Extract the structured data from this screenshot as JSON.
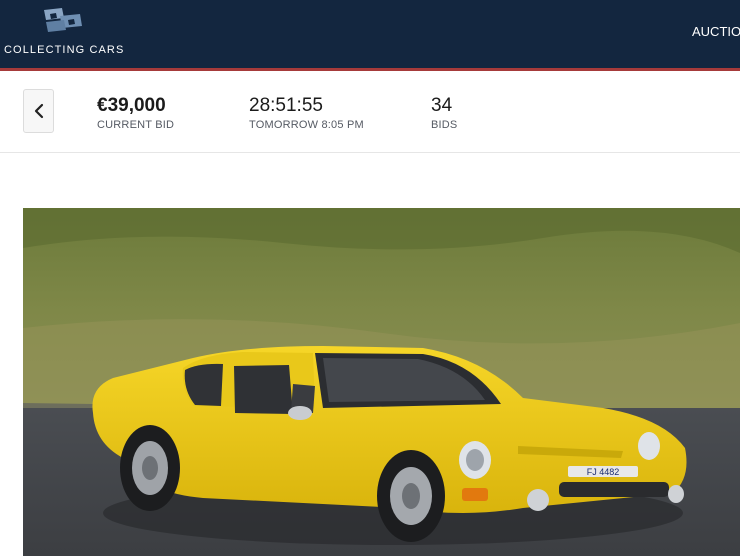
{
  "header": {
    "brand": "COLLECTING CARS",
    "nav_link": "AUCTIO",
    "colors": {
      "background": "#13263f",
      "accent_line": "#a63a3a"
    }
  },
  "bid_bar": {
    "back_icon": "chevron-left-icon",
    "current_bid": {
      "value": "€39,000",
      "label": "CURRENT BID"
    },
    "time_left": {
      "value": "28:51:55",
      "label": "TOMORROW 8:05 PM"
    },
    "bids": {
      "value": "34",
      "label": "BIDS"
    }
  },
  "photo": {
    "plate": "FJ 4482",
    "car_color": "#f2cf16"
  }
}
